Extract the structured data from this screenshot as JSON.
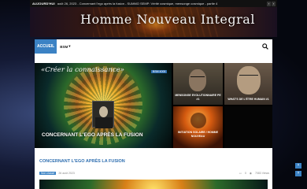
{
  "topbar": {
    "label": "AUJOURD'HUI",
    "ticker": "août 26, 2023 - Concernant l'ego après la fusion - SUMMO SEMP: Vérité cosmique, mensonge cosmique - partie 4"
  },
  "header": {
    "site_title": "Homme Nouveau Integral"
  },
  "nav": {
    "home_label": "ACCUEIL",
    "menu_label": "BSM"
  },
  "featured": {
    "overlay_text": "«Créer la connaissance»",
    "badge": "BSM 4000",
    "main_caption": "CONCERNANT L'EGO APRÈS LA FUSION",
    "tile_a_caption": "MENSONGE EVOLUTIONNAIRE PE #1",
    "tile_b_caption": "WHAT'S DE L'ÉTRE HUMAIN #1",
    "tile_c_caption": "INITIATION SOLAIRE / HOMME NOUVEAU"
  },
  "article": {
    "title": "CONCERNANT L'EGO APRÈS LA FUSION",
    "category": "Non classé",
    "date": "26 août 2023",
    "comments": "0",
    "views": "7083 Views"
  },
  "colors": {
    "accent": "#3b82c4",
    "title_link": "#2f6fb0"
  }
}
